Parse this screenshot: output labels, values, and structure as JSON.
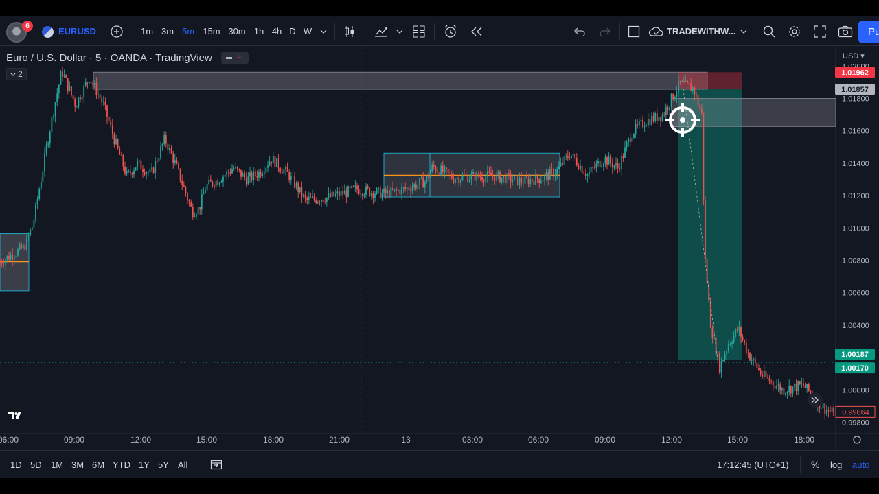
{
  "toolbar": {
    "notification_count": "6",
    "symbol": "EURUSD",
    "timeframes": [
      "1m",
      "3m",
      "5m",
      "15m",
      "30m",
      "1h",
      "4h",
      "D",
      "W"
    ],
    "active_timeframe": "5m",
    "layout_name": "TRADEWITHW...",
    "publish_label": "Pu"
  },
  "legend": {
    "title": "Euro / U.S. Dollar · 5 · OANDA · TradingView",
    "collapsed_count": "2"
  },
  "price_scale": {
    "currency": "USD",
    "tick_labels": [
      "1.02000",
      "1.01800",
      "1.01600",
      "1.01400",
      "1.01200",
      "1.01000",
      "1.00800",
      "1.00600",
      "1.00400",
      "1.00000",
      "0.99800"
    ],
    "badges": {
      "stop": "1.01962",
      "entry": "1.01857",
      "target_top": "1.00187",
      "target_bottom": "1.00170",
      "last": "0.99864"
    }
  },
  "time_scale": {
    "labels": [
      "06:00",
      "09:00",
      "12:00",
      "15:00",
      "18:00",
      "21:00",
      "13",
      "03:00",
      "06:00",
      "09:00",
      "12:00",
      "15:00",
      "18:00"
    ]
  },
  "bottom_bar": {
    "ranges": [
      "1D",
      "5D",
      "1M",
      "3M",
      "6M",
      "YTD",
      "1Y",
      "5Y",
      "All"
    ],
    "clock": "17:12:45 (UTC+1)",
    "percent_label": "%",
    "log_label": "log",
    "auto_label": "auto"
  },
  "colors": {
    "background": "#131722",
    "up": "#26a69a",
    "down": "#ef5350",
    "accent": "#2962ff",
    "stop_badge": "#f23645",
    "target_badge": "#089981"
  },
  "chart_data": {
    "type": "candlestick",
    "symbol": "EURUSD",
    "interval": "5",
    "ylim": [
      0.9973,
      1.0212
    ],
    "x_labels": [
      "06:00",
      "09:00",
      "12:00",
      "15:00",
      "18:00",
      "21:00",
      "13",
      "03:00",
      "06:00",
      "09:00",
      "12:00",
      "15:00",
      "18:00"
    ],
    "price_path": [
      [
        0,
        1.0079
      ],
      [
        35,
        1.0088
      ],
      [
        48,
        1.0102
      ],
      [
        70,
        1.0155
      ],
      [
        80,
        1.0177
      ],
      [
        90,
        1.0197
      ],
      [
        110,
        1.0176
      ],
      [
        130,
        1.0193
      ],
      [
        150,
        1.0177
      ],
      [
        170,
        1.015
      ],
      [
        185,
        1.0132
      ],
      [
        200,
        1.014
      ],
      [
        220,
        1.0133
      ],
      [
        240,
        1.0155
      ],
      [
        255,
        1.014
      ],
      [
        280,
        1.011
      ],
      [
        290,
        1.0112
      ],
      [
        300,
        1.0126
      ],
      [
        315,
        1.0129
      ],
      [
        340,
        1.0137
      ],
      [
        360,
        1.013
      ],
      [
        380,
        1.0135
      ],
      [
        395,
        1.0143
      ],
      [
        420,
        1.0133
      ],
      [
        445,
        1.0117
      ],
      [
        480,
        1.0119
      ],
      [
        520,
        1.0124
      ],
      [
        560,
        1.0121
      ],
      [
        590,
        1.0124
      ],
      [
        620,
        1.0129
      ],
      [
        630,
        1.0138
      ],
      [
        660,
        1.0131
      ],
      [
        690,
        1.0132
      ],
      [
        720,
        1.0132
      ],
      [
        760,
        1.0129
      ],
      [
        790,
        1.0131
      ],
      [
        810,
        1.0135
      ],
      [
        830,
        1.0146
      ],
      [
        855,
        1.0133
      ],
      [
        880,
        1.0143
      ],
      [
        900,
        1.0137
      ],
      [
        920,
        1.0159
      ],
      [
        940,
        1.0166
      ],
      [
        965,
        1.017
      ],
      [
        990,
        1.0189
      ],
      [
        1010,
        1.0186
      ],
      [
        1022,
        1.017
      ],
      [
        1026,
        1.0085
      ],
      [
        1035,
        1.004
      ],
      [
        1048,
        1.0014
      ],
      [
        1060,
        1.0028
      ],
      [
        1075,
        1.0038
      ],
      [
        1090,
        1.0022
      ],
      [
        1110,
        1.0009
      ],
      [
        1140,
        1.0
      ],
      [
        1170,
        1.0003
      ],
      [
        1190,
        0.9993
      ],
      [
        1205,
        0.9987
      ],
      [
        1215,
        0.9986
      ]
    ],
    "drawings": [
      {
        "kind": "supply-zone",
        "top": 1.01962,
        "bottom": 1.01857
      },
      {
        "kind": "range-box",
        "top": 1.01462,
        "bottom": 1.01192,
        "mid": 1.01326
      },
      {
        "kind": "range-box-left",
        "top": 1.00965,
        "bottom": 1.00612,
        "mid": 1.00791
      },
      {
        "kind": "gap-zone",
        "top": 1.018,
        "bottom": 1.01627
      },
      {
        "kind": "short-position",
        "entry": 1.01857,
        "stop": 1.01962,
        "target": 1.00187
      }
    ],
    "last_price": 0.99864,
    "grid": false
  }
}
